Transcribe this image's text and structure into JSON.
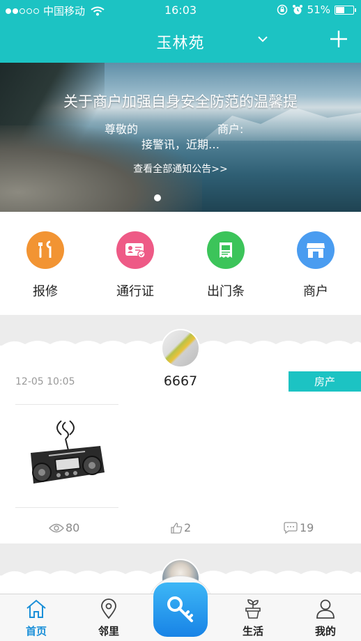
{
  "status_bar": {
    "carrier": "中国移动",
    "time": "16:03",
    "battery_percent": "51%",
    "battery_level": 0.51
  },
  "header": {
    "title": "玉林苑",
    "dropdown_icon": "chevron-down-icon",
    "add_icon": "plus-icon"
  },
  "banner": {
    "title": "关于商户加强自身安全防范的温馨提",
    "line1_left": "尊敬的",
    "line1_right": "商户:",
    "line2": "接警讯，近期…",
    "link": "查看全部通知公告>>",
    "page_count": 1,
    "active_page": 0
  },
  "actions": [
    {
      "label": "报修",
      "icon": "repair-tools-icon",
      "color": "#f29433"
    },
    {
      "label": "通行证",
      "icon": "id-card-icon",
      "color": "#ee5a86"
    },
    {
      "label": "出门条",
      "icon": "receipt-icon",
      "color": "#3cc45a"
    },
    {
      "label": "商户",
      "icon": "shop-icon",
      "color": "#4a9cf0"
    }
  ],
  "feed": [
    {
      "time": "12-05 10:05",
      "name": "6667",
      "tag": "房产",
      "views": "80",
      "likes": "2",
      "comments": "19"
    }
  ],
  "tabbar": {
    "tabs": [
      {
        "label": "首页",
        "icon": "home-icon",
        "active": true
      },
      {
        "label": "邻里",
        "icon": "location-pin-icon",
        "active": false
      },
      {
        "label": "生活",
        "icon": "plant-pot-icon",
        "active": false
      },
      {
        "label": "我的",
        "icon": "user-icon",
        "active": false
      }
    ],
    "center_icon": "key-icon"
  },
  "colors": {
    "accent": "#1cc3c3",
    "tab_active": "#1a8fd8"
  }
}
